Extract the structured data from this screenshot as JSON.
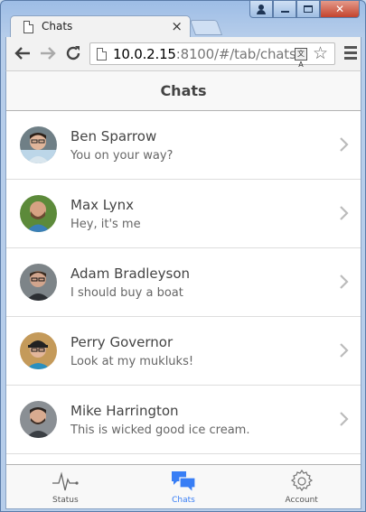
{
  "browser": {
    "tab_title": "Chats",
    "tab_close": "×",
    "url_host": "10.0.2.15",
    "url_rest": ":8100/#/tab/chats",
    "back_icon": "arrow-left-icon",
    "forward_icon": "arrow-right-icon",
    "reload_icon": "reload-icon",
    "bookmark_icon": "star-icon",
    "menu_icon": "hamburger-menu-icon"
  },
  "header": {
    "title": "Chats"
  },
  "chats": [
    {
      "name": "Ben Sparrow",
      "message": "You on your way?"
    },
    {
      "name": "Max Lynx",
      "message": "Hey, it's me"
    },
    {
      "name": "Adam Bradleyson",
      "message": "I should buy a boat"
    },
    {
      "name": "Perry Governor",
      "message": "Look at my mukluks!"
    },
    {
      "name": "Mike Harrington",
      "message": "This is wicked good ice cream."
    }
  ],
  "tabs": [
    {
      "label": "Status",
      "icon": "pulse-icon",
      "active": false
    },
    {
      "label": "Chats",
      "icon": "chatbubbles-icon",
      "active": true
    },
    {
      "label": "Account",
      "icon": "gear-icon",
      "active": false
    }
  ],
  "colors": {
    "accent": "#387ef5",
    "text": "#444444",
    "muted": "#666666"
  }
}
